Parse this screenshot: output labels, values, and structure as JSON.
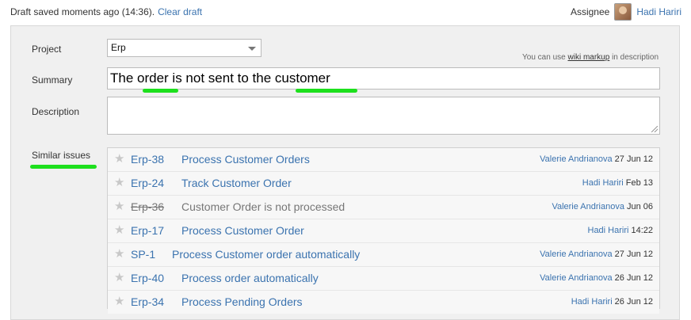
{
  "header": {
    "draft_text": "Draft saved moments ago (14:36).",
    "clear_draft": "Clear draft",
    "assignee_label": "Assignee",
    "assignee_name": "Hadi Hariri"
  },
  "form": {
    "project_label": "Project",
    "project_value": "Erp",
    "wiki_prefix": "You can use",
    "wiki_link": "wiki markup",
    "wiki_suffix": "in description",
    "summary_label": "Summary",
    "summary_value": "The order is not sent to the customer",
    "description_label": "Description",
    "similar_label": "Similar issues"
  },
  "similar_issues": [
    {
      "key": "Erp-38",
      "title": "Process Customer Orders",
      "who": "Valerie Andrianova",
      "when": "27 Jun 12",
      "resolved": false
    },
    {
      "key": "Erp-24",
      "title": "Track Customer Order",
      "who": "Hadi Hariri",
      "when": "Feb 13",
      "resolved": false
    },
    {
      "key": "Erp-36",
      "title": "Customer Order is not processed",
      "who": "Valerie Andrianova",
      "when": "Jun 06",
      "resolved": true
    },
    {
      "key": "Erp-17",
      "title": "Process Customer Order",
      "who": "Hadi Hariri",
      "when": "14:22",
      "resolved": false
    },
    {
      "key": "SP-1",
      "title": "Process Customer order automatically",
      "who": "Valerie Andrianova",
      "when": "27 Jun 12",
      "resolved": false
    },
    {
      "key": "Erp-40",
      "title": "Process order automatically",
      "who": "Valerie Andrianova",
      "when": "26 Jun 12",
      "resolved": false
    },
    {
      "key": "Erp-34",
      "title": "Process Pending Orders",
      "who": "Hadi Hariri",
      "when": "26 Jun 12",
      "resolved": false
    }
  ],
  "icons": {
    "star": "star-icon",
    "avatar": "user-avatar",
    "caret": "chevron-down-icon"
  },
  "colors": {
    "link": "#3b73af",
    "highlight": "#1de01d",
    "panel": "#f0f0f0"
  }
}
